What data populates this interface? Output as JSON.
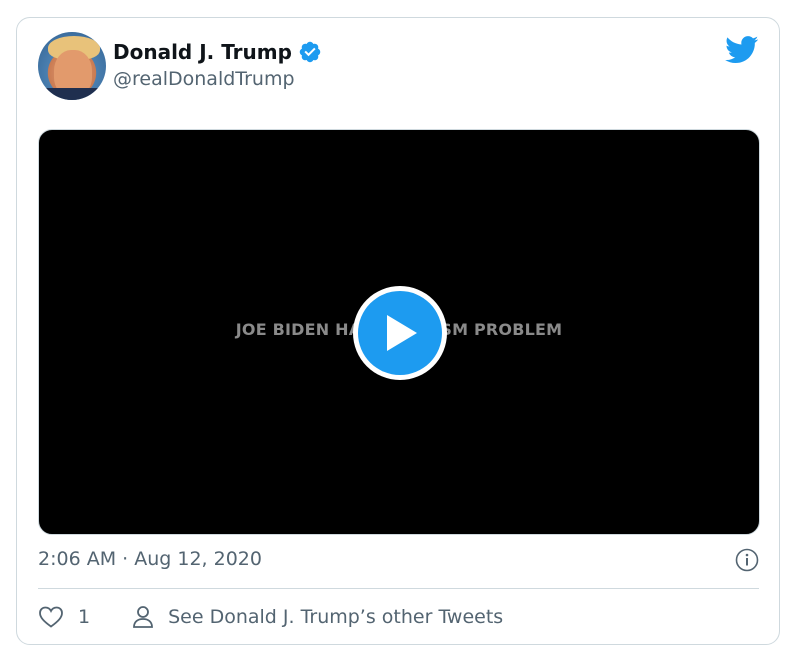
{
  "tweet": {
    "author_name": "Donald J. Trump",
    "handle": "@realDonaldTrump",
    "verified": true,
    "timestamp": "2:06 AM · Aug 12, 2020",
    "like_count": "1",
    "other_tweets_link": "See Donald J. Trump’s other Tweets"
  },
  "media": {
    "type": "video",
    "overlay_text": "JOE BIDEN HAS A RACISM PROBLEM"
  },
  "icons": {
    "avatar": "avatar",
    "verified": "verified-badge-icon",
    "brand": "twitter-bird-icon",
    "play": "play-icon",
    "info": "info-icon",
    "like": "heart-icon",
    "profile": "person-icon"
  },
  "colors": {
    "brand": "#1d9bf0",
    "text_primary": "#0f1419",
    "text_secondary": "#536471",
    "border": "#cfd9de",
    "media_background": "#000000"
  }
}
